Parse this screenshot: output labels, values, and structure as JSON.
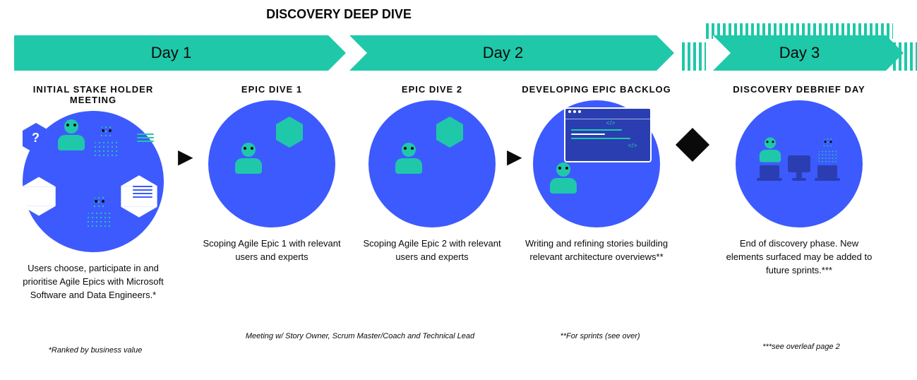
{
  "section1_label": "DISCOVERY DEEP DIVE",
  "section2_label": "",
  "days": {
    "d1": "Day 1",
    "d2": "Day 2",
    "d3": "Day 3"
  },
  "phases": [
    {
      "title": "INITIAL STAKE HOLDER MEETING",
      "desc": "Users choose, participate in and prioritise Agile Epics with Microsoft Software and Data Engineers.*",
      "foot": "*Ranked by business value"
    },
    {
      "title": "EPIC DIVE 1",
      "desc": "Scoping Agile Epic 1 with relevant users and experts"
    },
    {
      "title": "EPIC DIVE 2",
      "desc": "Scoping Agile Epic 2 with relevant users and experts"
    },
    {
      "title": "DEVELOPING EPIC BACKLOG",
      "desc": "Writing and refining stories building relevant architecture overviews**",
      "foot": "**For sprints (see over)"
    },
    {
      "title": "DISCOVERY DEBRIEF DAY",
      "desc": "End of discovery phase. New elements surfaced may be added to future sprints.***",
      "foot": "***see overleaf page 2"
    }
  ],
  "shared_footnote": "Meeting w/ Story Owner, Scrum Master/Coach and Technical Lead",
  "colors": {
    "blue": "#3d5afe",
    "teal": "#1fc8a9",
    "black": "#0a0a0a"
  }
}
